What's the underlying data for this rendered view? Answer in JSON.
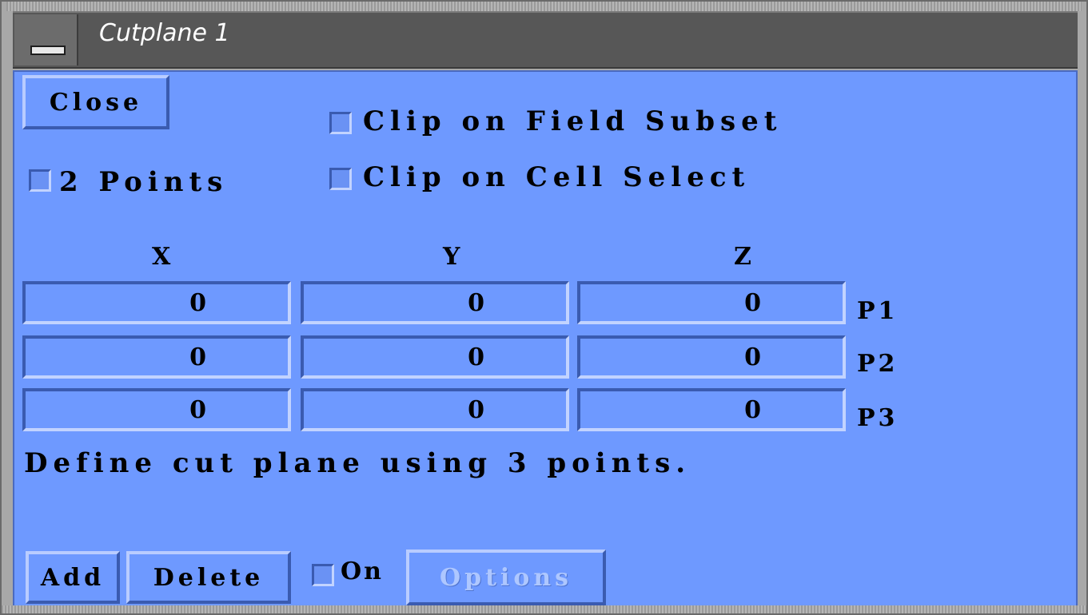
{
  "window": {
    "title": "Cutplane 1"
  },
  "buttons": {
    "close": "Close",
    "add": "Add",
    "delete": "Delete",
    "options": "Options"
  },
  "checkboxes": {
    "two_points": {
      "label": "2 Points",
      "checked": false
    },
    "clip_field_subset": {
      "label": "Clip on Field Subset",
      "checked": false
    },
    "clip_cell_select": {
      "label": "Clip on Cell Select",
      "checked": false
    },
    "on": {
      "label": "On",
      "checked": false
    }
  },
  "columns": [
    "X",
    "Y",
    "Z"
  ],
  "points": [
    {
      "label": "P1",
      "x": "0",
      "y": "0",
      "z": "0"
    },
    {
      "label": "P2",
      "x": "0",
      "y": "0",
      "z": "0"
    },
    {
      "label": "P3",
      "x": "0",
      "y": "0",
      "z": "0"
    }
  ],
  "status": "Define cut plane using 3 points.",
  "colors": {
    "panel": "#6e99ff",
    "titlebar": "#575757"
  }
}
